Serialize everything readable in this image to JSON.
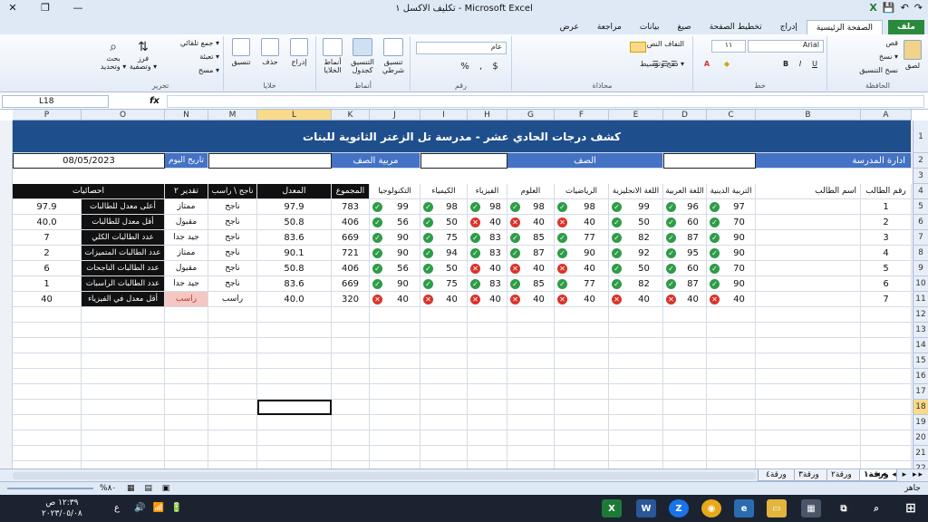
{
  "window": {
    "title": "تكليف الاكسل ١ - Microsoft Excel"
  },
  "tabs": [
    "ملف",
    "الصفحة الرئيسية",
    "إدراج",
    "تخطيط الصفحة",
    "صيغ",
    "بيانات",
    "مراجعة",
    "عرض"
  ],
  "ribbon": {
    "groups": [
      "الحافظة",
      "خط",
      "محاذاة",
      "رقم",
      "أنماط",
      "خلايا",
      "تحرير"
    ],
    "paste": "لصق",
    "cut": "قص",
    "copy": "نسخ ▾",
    "format_painter": "نسخ التنسيق",
    "font_name": "Arial",
    "font_size": "١١",
    "wrap_text": "التفاف النص",
    "merge_center": "دمج وتوسيط ▾",
    "number_format": "عام",
    "conditional": "تنسيق شرطي",
    "format_table": "التنسيق كجدول",
    "cell_styles": "أنماط الخلايا",
    "insert": "إدراج",
    "delete": "حذف",
    "format": "تنسيق",
    "autosum": "جمع تلقائي ▾",
    "fill": "تعبئة ▾",
    "clear": "مسح ▾",
    "sort_filter": "فرز وتصفية ▾",
    "find_select": "بحث وتحديد ▾"
  },
  "formula_bar": {
    "name_box": "L18",
    "fx": "fx",
    "content": ""
  },
  "columns": [
    "A",
    "B",
    "C",
    "D",
    "E",
    "F",
    "G",
    "H",
    "I",
    "J",
    "K",
    "L",
    "M",
    "N",
    "O",
    "P"
  ],
  "rows": [
    "1",
    "2",
    "3",
    "4",
    "5",
    "6",
    "7",
    "8",
    "9",
    "10",
    "11",
    "12",
    "13",
    "14",
    "15",
    "16",
    "17",
    "18",
    "19",
    "20",
    "21",
    "22",
    "23"
  ],
  "selected": {
    "column": "L",
    "row": "18"
  },
  "sheet": {
    "banner": "كشف درجات الحادي عشر - مدرسة تل الزعتر الثانوية للبنات",
    "row2": {
      "admin": "ادارة المدرسة",
      "class": "الصف",
      "supervisor": "مربية الصف",
      "today_label": "تاريخ اليوم",
      "today_value": "08/05/2023"
    },
    "headers": {
      "student_no": "رقم الطالب",
      "student_name": "اسم الطالب",
      "subjects": [
        "التربية الدينية",
        "اللغة العربية",
        "اللغة الانجليزية",
        "الرياضيات",
        "العلوم",
        "الفيزياء",
        "الكيمياء",
        "التكنولوجيا"
      ],
      "total": "المجموع",
      "average": "المعدل",
      "pass_fail": "ناجح \\ راسب",
      "grade": "تقدير ٢",
      "stats": "احصائيات"
    },
    "students": [
      {
        "no": "1",
        "scores": [
          "97",
          "96",
          "99",
          "98",
          "98",
          "98",
          "98",
          "99"
        ],
        "total": "783",
        "avg": "97.9",
        "result": "ناجح",
        "grade": "ممتاز"
      },
      {
        "no": "2",
        "scores": [
          "70",
          "60",
          "50",
          "40",
          "40",
          "40",
          "50",
          "56"
        ],
        "total": "406",
        "avg": "50.8",
        "result": "ناجح",
        "grade": "مقبول"
      },
      {
        "no": "3",
        "scores": [
          "90",
          "87",
          "82",
          "77",
          "85",
          "83",
          "75",
          "90"
        ],
        "total": "669",
        "avg": "83.6",
        "result": "ناجح",
        "grade": "جيد جدا"
      },
      {
        "no": "4",
        "scores": [
          "90",
          "95",
          "92",
          "90",
          "87",
          "83",
          "94",
          "90"
        ],
        "total": "721",
        "avg": "90.1",
        "result": "ناجح",
        "grade": "ممتاز"
      },
      {
        "no": "5",
        "scores": [
          "70",
          "60",
          "50",
          "40",
          "40",
          "40",
          "50",
          "56"
        ],
        "total": "406",
        "avg": "50.8",
        "result": "ناجح",
        "grade": "مقبول"
      },
      {
        "no": "6",
        "scores": [
          "90",
          "87",
          "82",
          "77",
          "85",
          "83",
          "75",
          "90"
        ],
        "total": "669",
        "avg": "83.6",
        "result": "ناجح",
        "grade": "جيد جدا"
      },
      {
        "no": "7",
        "scores": [
          "40",
          "40",
          "40",
          "40",
          "40",
          "40",
          "40",
          "40"
        ],
        "total": "320",
        "avg": "40.0",
        "result": "راسب",
        "grade": "راسب"
      }
    ],
    "stats": [
      {
        "label": "أعلى معدل للطالبات",
        "value": "97.9"
      },
      {
        "label": "أقل معدل للطالبات",
        "value": "40.0"
      },
      {
        "label": "عدد الطالبات الكلي",
        "value": "7"
      },
      {
        "label": "عدد الطالبات المتميزات",
        "value": "2"
      },
      {
        "label": "عدد الطالبات الناجحات",
        "value": "6"
      },
      {
        "label": "عدد الطالبات الراسبات",
        "value": "1"
      },
      {
        "label": "أقل معدل في الفيزياء",
        "value": "40"
      }
    ]
  },
  "sheet_tabs": [
    "ورقة١",
    "ورقة٢",
    "ورقة٣",
    "ورقة٤"
  ],
  "status": {
    "ready": "جاهز",
    "zoom": "%٨٠"
  },
  "taskbar": {
    "time": "١٢:٣٩ ص",
    "date": "٢٠٢٣/٠٥/٠٨",
    "lang": "ع"
  },
  "colors": {
    "banner": "#1f4e8c",
    "header_blue": "#4472c4",
    "ok": "#2e9c47",
    "bad": "#d9342b"
  }
}
